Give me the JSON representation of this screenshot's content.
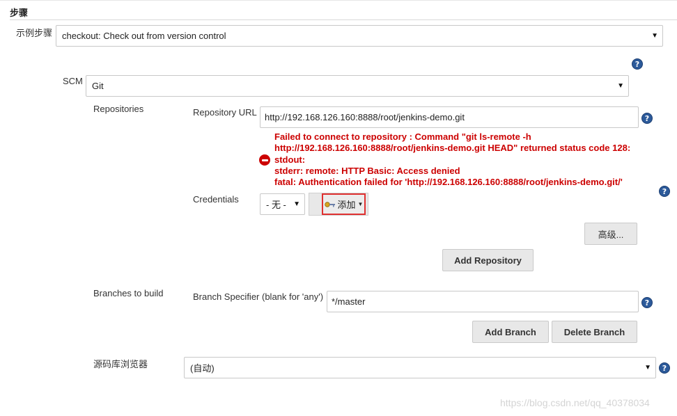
{
  "section": {
    "title": "步骤"
  },
  "sample_step": {
    "label": "示例步骤",
    "value": "checkout: Check out from version control"
  },
  "scm": {
    "label": "SCM",
    "value": "Git"
  },
  "repositories": {
    "label": "Repositories",
    "url_label": "Repository URL",
    "url_value": "http://192.168.126.160:8888/root/jenkins-demo.git",
    "error_lines": [
      "Failed to connect to repository : Command \"git ls-remote -h",
      "http://192.168.126.160:8888/root/jenkins-demo.git HEAD\" returned status code 128:",
      "stdout:",
      "stderr: remote: HTTP Basic: Access denied",
      "fatal: Authentication failed for 'http://192.168.126.160:8888/root/jenkins-demo.git/'"
    ],
    "credentials_label": "Credentials",
    "credentials_value": "- 无 -",
    "add_label": "添加",
    "advanced_label": "高级...",
    "add_repository_label": "Add Repository"
  },
  "branches": {
    "label": "Branches to build",
    "specifier_label": "Branch Specifier (blank for 'any')",
    "specifier_value": "*/master",
    "add_branch_label": "Add Branch",
    "delete_branch_label": "Delete Branch"
  },
  "browser": {
    "label": "源码库浏览器",
    "value": "(自动)"
  },
  "help_glyph": "?",
  "watermark": "https://blog.csdn.net/qq_40378034",
  "colors": {
    "error": "#cc0000",
    "help_icon": "#2c5a9a",
    "highlight_border": "#e03030"
  }
}
